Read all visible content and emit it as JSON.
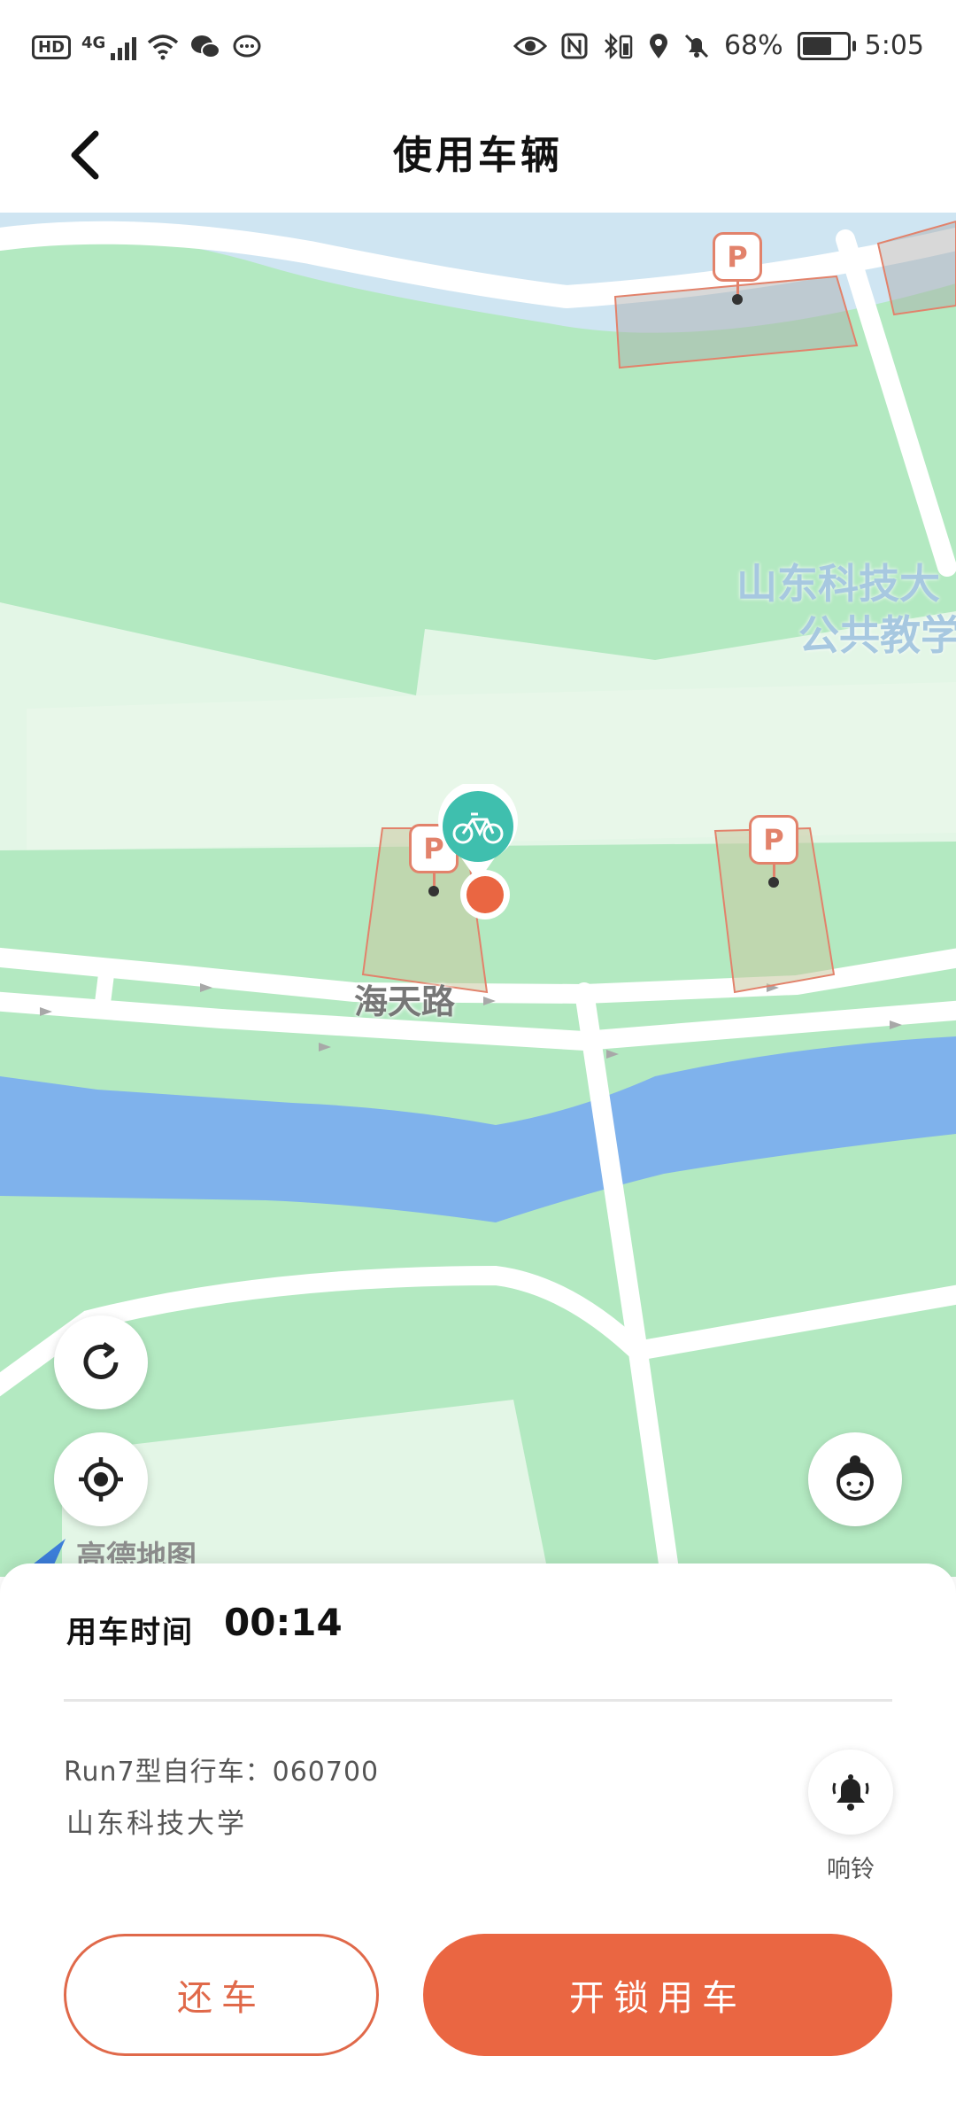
{
  "status_bar": {
    "left_badge": "HD",
    "network": "4G",
    "battery_percent": "68%",
    "battery_level": 0.68,
    "time": "5:05",
    "icons": [
      "signal-icon",
      "wifi-icon",
      "wechat-icon",
      "chat-icon",
      "eye-icon",
      "nfc-icon",
      "bluetooth-icon",
      "location-icon",
      "mute-icon",
      "battery-icon"
    ]
  },
  "header": {
    "title": "使用车辆",
    "back_icon": "chevron-left-icon"
  },
  "map": {
    "campus_label_line1": "山东科技大",
    "campus_label_line2": "公共教学",
    "road_label": "海天路",
    "parking_marker": "P",
    "provider_label": "高德地图",
    "colors": {
      "land": "#b3e9c1",
      "water": "#cfe5f2",
      "river": "#7fb2ec",
      "road": "#ffffff",
      "parking": "#e2826b",
      "bike_pin": "#3fbfae",
      "user_dot": "#ea6642"
    }
  },
  "controls": {
    "refresh_icon": "refresh-icon",
    "locate_icon": "locate-icon",
    "service_icon": "customer-service-icon"
  },
  "sheet": {
    "time_label": "用车时间",
    "time_value": "00:14",
    "bike_info": "Run7型自行车：060700",
    "school": "山东科技大学",
    "bell_label": "响铃",
    "return_label": "还车",
    "unlock_label": "开锁用车"
  }
}
